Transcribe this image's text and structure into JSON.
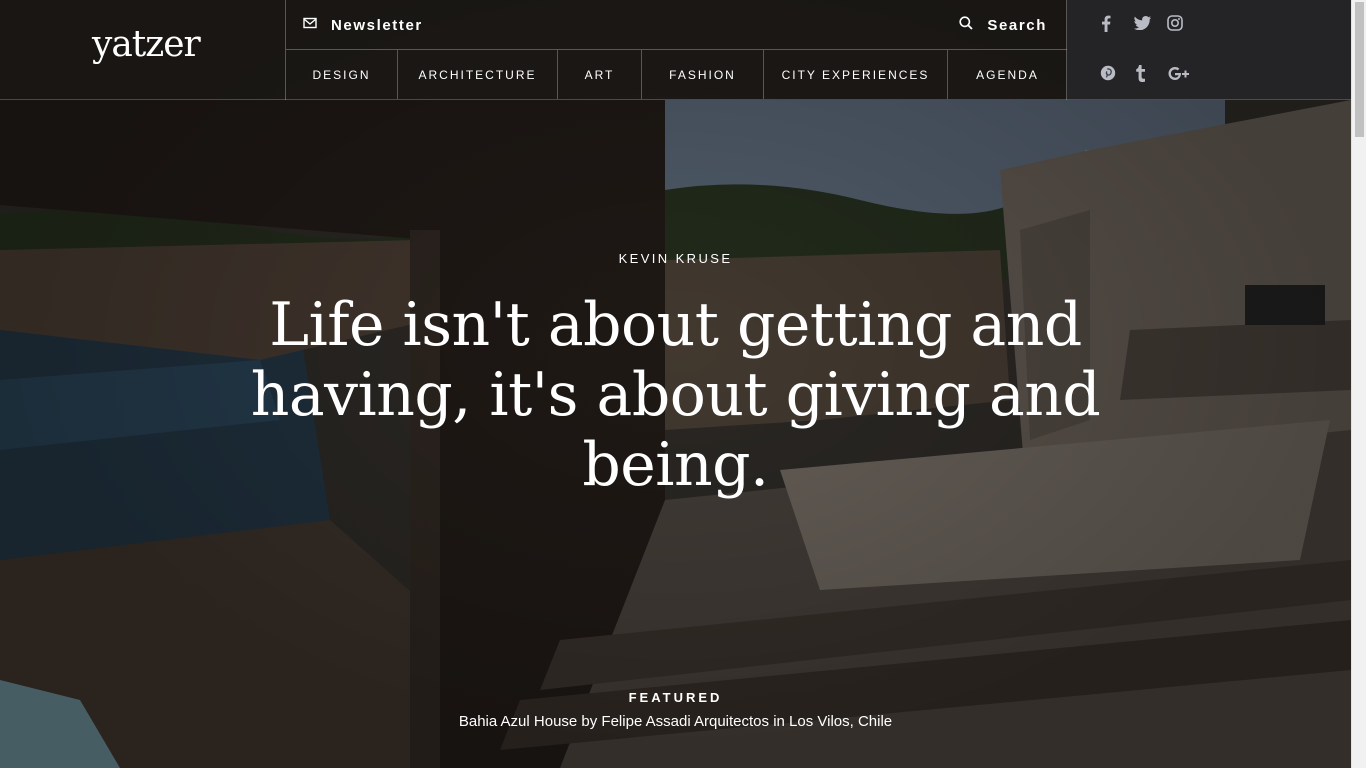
{
  "brand": {
    "logo_text": "yatzer"
  },
  "header": {
    "newsletter_label": "Newsletter",
    "search_label": "Search",
    "nav": [
      "DESIGN",
      "ARCHITECTURE",
      "ART",
      "FASHION",
      "CITY EXPERIENCES",
      "AGENDA"
    ]
  },
  "social": [
    "facebook-icon",
    "twitter-icon",
    "instagram-icon",
    "pinterest-icon",
    "tumblr-icon",
    "google-plus-icon"
  ],
  "hero": {
    "author": "KEVIN KRUSE",
    "quote": "Life isn't about getting and having, it's about giving and being."
  },
  "featured": {
    "label": "FEATURED",
    "title": "Bahia Azul House by Felipe Assadi Arquitectos in Los Vilos, Chile"
  },
  "colors": {
    "text": "#ffffff",
    "overlay": "#14100e"
  }
}
